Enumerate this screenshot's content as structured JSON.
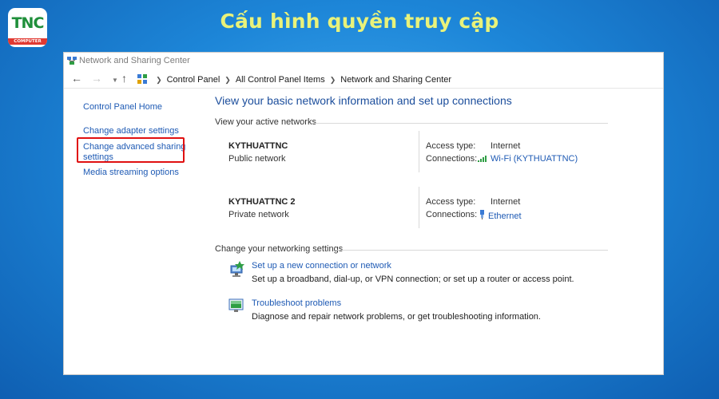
{
  "banner": {
    "title": "Cấu hình quyền truy cập",
    "logo_text": "TNC",
    "logo_sub": "COMPUTER"
  },
  "window": {
    "title": "Network and Sharing Center",
    "breadcrumbs": [
      "Control Panel",
      "All Control Panel Items",
      "Network and Sharing Center"
    ]
  },
  "sidebar": {
    "items": [
      "Control Panel Home",
      "Change adapter settings",
      "Change advanced sharing",
      "settings",
      "Media streaming options"
    ],
    "highlighted": "Change advanced sharing settings"
  },
  "main": {
    "title": "View your basic network information and set up connections",
    "active_networks_heading": "View your active networks",
    "networks": [
      {
        "name": "KYTHUATTNC",
        "type": "Public network",
        "access_label": "Access type:",
        "access_value": "Internet",
        "conn_label": "Connections:",
        "conn_value": "Wi-Fi (KYTHUATTNC)",
        "icon": "wifi-icon"
      },
      {
        "name": "KYTHUATTNC 2",
        "type": "Private network",
        "access_label": "Access type:",
        "access_value": "Internet",
        "conn_label": "Connections:",
        "conn_value": "Ethernet",
        "icon": "ethernet-icon"
      }
    ],
    "settings_heading": "Change your networking settings",
    "tasks": [
      {
        "link": "Set up a new connection or network",
        "desc": "Set up a broadband, dial-up, or VPN connection; or set up a router or access point.",
        "icon": "new-connection-icon"
      },
      {
        "link": "Troubleshoot problems",
        "desc": "Diagnose and repair network problems, or get troubleshooting information.",
        "icon": "troubleshoot-icon"
      }
    ]
  },
  "colors": {
    "link": "#1e5ab4",
    "title": "#1c4e9c",
    "highlight": "#e01010",
    "banner_text": "#e9f27a"
  }
}
